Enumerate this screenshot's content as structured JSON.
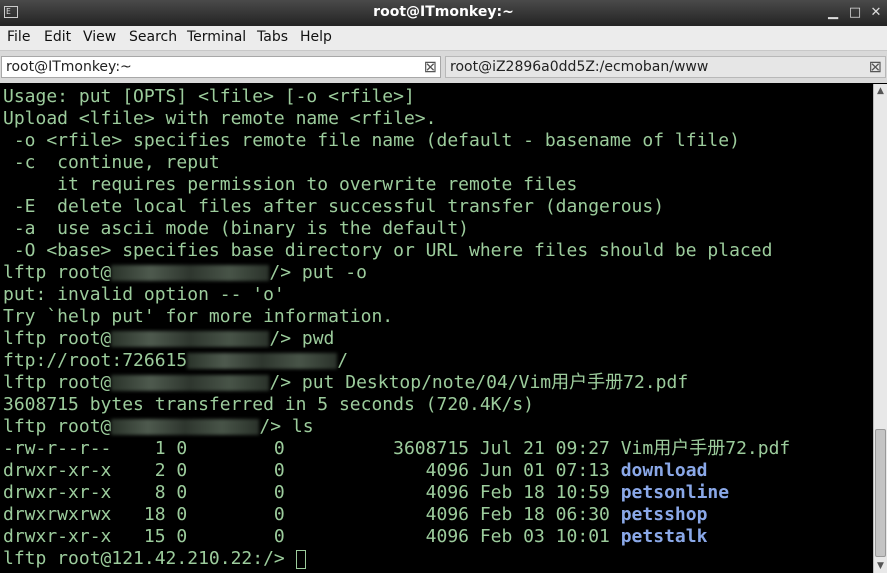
{
  "window": {
    "title": "root@ITmonkey:~",
    "icon_text": "E",
    "minimize_glyph": "▁",
    "maximize_glyph": "□",
    "close_glyph": "✕"
  },
  "menu": [
    "File",
    "Edit",
    "View",
    "Search",
    "Terminal",
    "Tabs",
    "Help"
  ],
  "tabs": [
    {
      "label": "root@ITmonkey:~",
      "active": true
    },
    {
      "label": "root@iZ2896a0dd5Z:/ecmoban/www",
      "active": false
    }
  ],
  "tab_close_glyph": "⊠",
  "terminal": {
    "lines": [
      "Usage: put [OPTS] <lfile> [-o <rfile>]",
      "Upload <lfile> with remote name <rfile>.",
      " -o <rfile> specifies remote file name (default - basename of lfile)",
      " -c  continue, reput",
      "     it requires permission to overwrite remote files",
      " -E  delete local files after successful transfer (dangerous)",
      " -a  use ascii mode (binary is the default)",
      " -O <base> specifies base directory or URL where files should be placed"
    ],
    "prompt_user": "lftp root@",
    "cmd_put_o": "/> put -o",
    "err_invalid": "put: invalid option -- 'o'",
    "err_try": "Try `help put' for more information.",
    "cmd_pwd": "/> pwd",
    "pwd_out_prefix": "ftp://root:726615",
    "pwd_out_suffix": "/",
    "cmd_put_file": "/> put Desktop/note/04/Vim用户手册72.pdf",
    "transfer": "3608715 bytes transferred in 5 seconds (720.4K/s)",
    "cmd_ls": "/> ls",
    "ls": [
      {
        "perm": "-rw-r--r--",
        "links": "1",
        "owner": "0",
        "group": "0",
        "size": "3608715",
        "date": "Jul 21 09:27",
        "name": "Vim用户手册72.pdf",
        "dir": false
      },
      {
        "perm": "drwxr-xr-x",
        "links": "2",
        "owner": "0",
        "group": "0",
        "size": "4096",
        "date": "Jun 01 07:13",
        "name": "download",
        "dir": true
      },
      {
        "perm": "drwxr-xr-x",
        "links": "8",
        "owner": "0",
        "group": "0",
        "size": "4096",
        "date": "Feb 18 10:59",
        "name": "petsonline",
        "dir": true
      },
      {
        "perm": "drwxrwxrwx",
        "links": "18",
        "owner": "0",
        "group": "0",
        "size": "4096",
        "date": "Feb 18 06:30",
        "name": "petsshop",
        "dir": true
      },
      {
        "perm": "drwxr-xr-x",
        "links": "15",
        "owner": "0",
        "group": "0",
        "size": "4096",
        "date": "Feb 03 10:01",
        "name": "petstalk",
        "dir": true
      }
    ],
    "final_prompt": "lftp root@121.42.210.22:/> "
  },
  "scrollbar": {
    "up_glyph": "▲",
    "down_glyph": "▼"
  }
}
